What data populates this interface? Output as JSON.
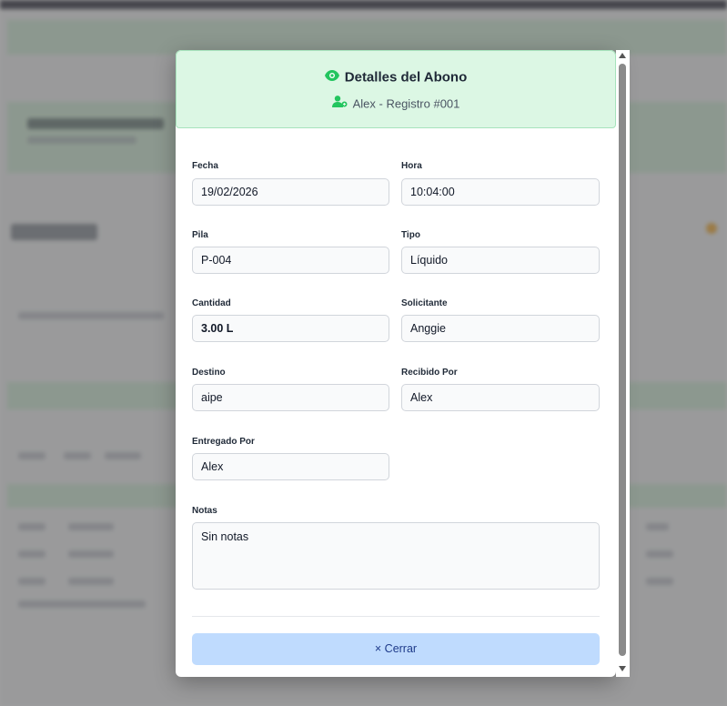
{
  "modal": {
    "title": "Detalles del Abono",
    "subtitle": "Alex - Registro #001",
    "accent_color": "#22c55e",
    "header_bg": "#dcf7e4",
    "fields": {
      "fecha": {
        "label": "Fecha",
        "value": "19/02/2026"
      },
      "hora": {
        "label": "Hora",
        "value": "10:04:00"
      },
      "pila": {
        "label": "Pila",
        "value": "P-004"
      },
      "tipo": {
        "label": "Tipo",
        "value": "Líquido"
      },
      "cantidad": {
        "label": "Cantidad",
        "value": "3.00 L"
      },
      "solicitante": {
        "label": "Solicitante",
        "value": "Anggie"
      },
      "destino": {
        "label": "Destino",
        "value": "aipe"
      },
      "recibido_por": {
        "label": "Recibido Por",
        "value": "Alex"
      },
      "entregado_por": {
        "label": "Entregado Por",
        "value": "Alex"
      },
      "notas": {
        "label": "Notas",
        "value": "Sin notas"
      }
    },
    "close_label": "× Cerrar",
    "close_color": "#bfdbfe"
  },
  "icons": {
    "title_icon": "eye-icon",
    "subtitle_icon": "user-icon"
  }
}
